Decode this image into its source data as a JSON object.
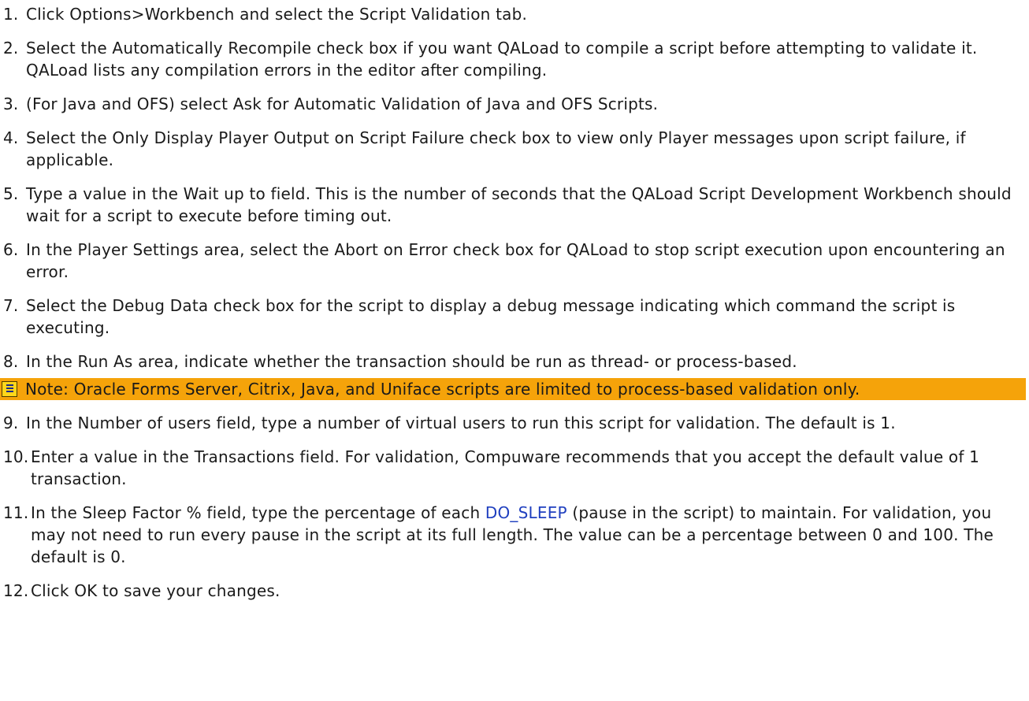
{
  "steps": [
    {
      "num": "1.",
      "text": "Click Options>Workbench and select the Script Validation tab."
    },
    {
      "num": "2.",
      "text": "Select the Automatically Recompile check box if you want QALoad to compile a script before attempting to validate it. QALoad lists any compilation errors in the editor after compiling."
    },
    {
      "num": "3.",
      "text": "(For Java and OFS) select Ask for Automatic Validation of Java and OFS Scripts."
    },
    {
      "num": "4.",
      "text": "Select the Only Display Player Output on Script Failure check box to view only Player messages upon script failure, if applicable."
    },
    {
      "num": "5.",
      "text": "Type a value in the Wait up to field. This is the number of seconds that the QALoad Script Development Workbench should wait for a script to execute before timing out."
    },
    {
      "num": "6.",
      "text": "In the Player Settings area, select the Abort on Error check box for QALoad to stop script execution upon encountering an error."
    },
    {
      "num": "7.",
      "text": "Select the Debug Data check box for the script to display a debug message indicating which command the script is executing."
    },
    {
      "num": "8.",
      "text": "In the Run As area, indicate whether the transaction should be run as thread- or process-based."
    }
  ],
  "note": {
    "icon": "note-icon",
    "text": "Note: Oracle Forms Server, Citrix, Java, and Uniface scripts are limited to process-based validation only."
  },
  "steps_after": [
    {
      "num": "9.",
      "text": "In the Number of users field, type a number of virtual users to run this script for validation. The default is 1."
    },
    {
      "num": "10.",
      "text": "Enter a value in the Transactions field. For validation, Compuware recommends that you accept the default value of 1 transaction."
    },
    {
      "num": "11.",
      "text_before": "In the Sleep Factor % field, type the percentage of each ",
      "link": "DO_SLEEP",
      "text_after": " (pause in the script) to maintain. For validation, you may not need to run every pause in the script at its full length. The value can be a percentage between 0 and 100. The default is 0."
    },
    {
      "num": "12.",
      "text": "Click OK to save your changes."
    }
  ],
  "colors": {
    "note_background": "#f5a30a",
    "link": "#1f3fbf"
  }
}
